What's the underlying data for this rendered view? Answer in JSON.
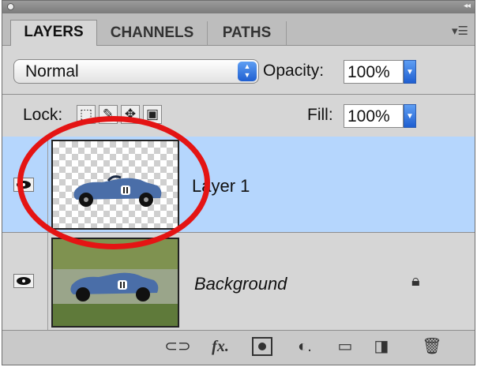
{
  "panel": {
    "tabs": [
      {
        "label": "LAYERS",
        "active": true
      },
      {
        "label": "CHANNELS",
        "active": false
      },
      {
        "label": "PATHS",
        "active": false
      }
    ]
  },
  "blend_mode": {
    "value": "Normal"
  },
  "opacity": {
    "label": "Opacity:",
    "value": "100%"
  },
  "lock": {
    "label": "Lock:",
    "icons": [
      "lock-transparent-pixels-icon",
      "lock-image-pixels-icon",
      "lock-position-icon",
      "lock-all-icon"
    ]
  },
  "fill": {
    "label": "Fill:",
    "value": "100%"
  },
  "layers": [
    {
      "name": "Layer 1",
      "selected": true,
      "visible": true,
      "locked": false
    },
    {
      "name": "Background",
      "selected": false,
      "visible": true,
      "locked": true
    }
  ],
  "footer_icons": [
    "link-layers-icon",
    "fx-layer-style-icon",
    "layer-mask-icon",
    "adjustment-layer-icon",
    "new-group-icon",
    "new-layer-icon",
    "delete-layer-icon"
  ],
  "colors": {
    "selection": "#b5d6fd",
    "annotation": "#e41414",
    "accent": "#1f5fd1"
  }
}
